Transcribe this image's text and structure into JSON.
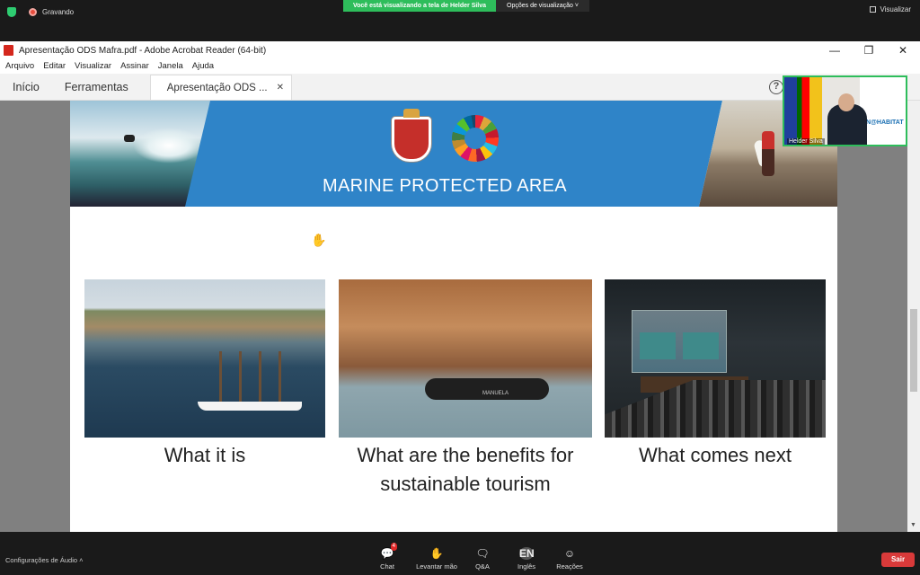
{
  "zoom": {
    "recording_label": "Gravando",
    "sharing_notice": "Você está visualizando a tela de Helder Silva",
    "view_options": "Opções de visualização",
    "view_button": "Visualizar",
    "bottom": {
      "audio_settings": "Configurações de Áudio",
      "chat": "Chat",
      "chat_badge": "4",
      "raise_hand": "Levantar mão",
      "qa": "Q&A",
      "language_code": "EN",
      "language": "Inglês",
      "reactions": "Reações",
      "leave": "Sair"
    },
    "participant_name": "Helder Silva",
    "participant_banner_text": "UN@HABITAT"
  },
  "acrobat": {
    "window_title": "Apresentação ODS Mafra.pdf - Adobe Acrobat Reader (64-bit)",
    "window_controls": [
      "—",
      "❐",
      "✕"
    ],
    "menu": [
      "Arquivo",
      "Editar",
      "Visualizar",
      "Assinar",
      "Janela",
      "Ajuda"
    ],
    "tabs": {
      "home": "Início",
      "tools": "Ferramentas",
      "document": "Apresentação ODS ...",
      "close": "✕"
    },
    "help_icon": "?"
  },
  "slide": {
    "banner_title": "MARINE PROTECTED AREA",
    "captions": [
      "What it is",
      "What are the benefits for sustainable tourism",
      "What comes next"
    ],
    "boat_text": "MANUELA",
    "colors": {
      "banner_blue": "#2f84c8",
      "zoom_green": "#2ebd5b",
      "leave_red": "#d93a3a"
    }
  }
}
